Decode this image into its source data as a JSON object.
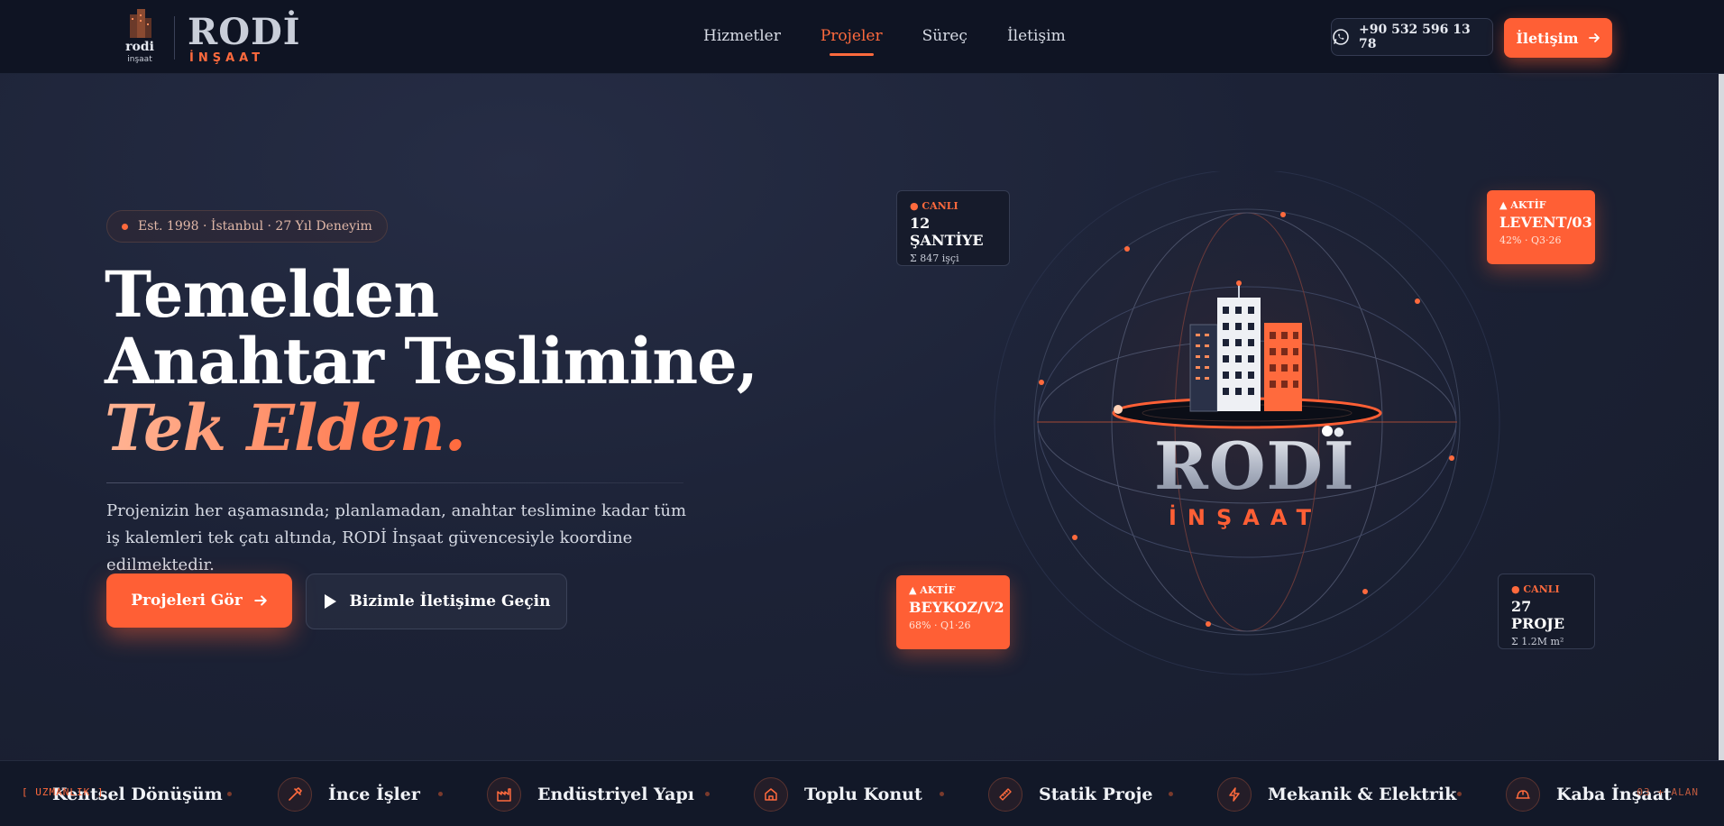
{
  "nav": {
    "logo_text": "RODİ",
    "logo_sub": "İNŞAAT",
    "logo_mark_text": "rodi inşaat",
    "links": [
      {
        "label": "Hizmetler"
      },
      {
        "label": "Projeler"
      },
      {
        "label": "Süreç"
      },
      {
        "label": "İletişim"
      }
    ],
    "phone": "+90 532 596 13 78",
    "contact_label": "İletişim"
  },
  "hero": {
    "badge": "Est. 1998 · İstanbul · 27 Yıl Deneyim",
    "headline_1": "Temelden",
    "headline_2": "Anahtar Teslimine,",
    "headline_accent": "Tek Elden.",
    "lead": "Projenizin her aşamasında; planlamadan, anahtar teslimine kadar tüm iş kalemleri tek çatı altında, RODİ İnşaat güvencesiyle koordine edilmektedir.",
    "cta_primary": "Projeleri Gör",
    "cta_secondary": "Bizimle İletişime Geçin"
  },
  "visual": {
    "brand": "RODİ",
    "brand_sub": "İNŞAAT",
    "cards": [
      {
        "tag": "● CANLI",
        "title": "12 ŞANTİYE",
        "sub": "Σ 847 işçi"
      },
      {
        "tag": "▲ AKTİF",
        "title": "LEVENT/03",
        "sub": "42% · Q3·26"
      },
      {
        "tag": "▲ AKTİF",
        "title": "BEYKOZ/V2",
        "sub": "68% · Q1·26"
      },
      {
        "tag": "● CANLI",
        "title": "27 PROJE",
        "sub": "Σ 1.2M m²"
      }
    ]
  },
  "ticker": {
    "left_tag": "[ UZMANLIK ]",
    "right_tag": "03 + ALAN",
    "items": [
      {
        "label": "Kentsel Dönüşüm",
        "icon": "building-icon"
      },
      {
        "label": "İnce İşler",
        "icon": "hammer-icon"
      },
      {
        "label": "Endüstriyel Yapı",
        "icon": "factory-icon"
      },
      {
        "label": "Toplu Konut",
        "icon": "home-icon"
      },
      {
        "label": "Statik Proje",
        "icon": "ruler-icon"
      },
      {
        "label": "Mekanik & Elektrik",
        "icon": "bolt-icon"
      },
      {
        "label": "Kaba İnşaat",
        "icon": "helmet-icon"
      }
    ]
  },
  "colors": {
    "accent": "#ff5f35",
    "nav_bg": "#0f1423",
    "bg": "#1c2236"
  }
}
